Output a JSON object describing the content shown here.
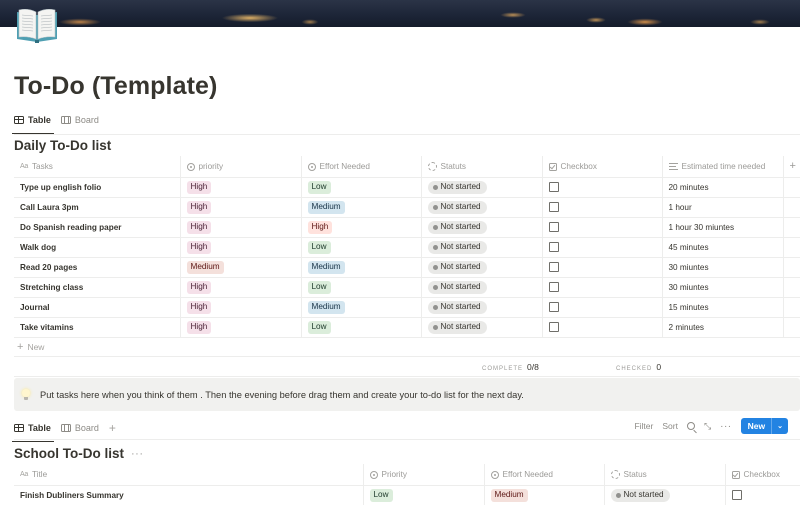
{
  "page": {
    "title": "To-Do (Template)",
    "icon": "open-book-icon"
  },
  "colors": {
    "accent": "#2383e2",
    "tag_high_priority_bg": "#f5e0e9",
    "tag_high_priority_fg": "#4c2337",
    "tag_medium_priority_bg": "#f4e0db",
    "tag_medium_priority_fg": "#5d1715",
    "effort_low_bg": "#dbeddb",
    "effort_low_fg": "#1c3829",
    "effort_medium_bg": "#d3e5ef",
    "effort_medium_fg": "#183347",
    "effort_high_bg": "#ffe2dd",
    "effort_high_fg": "#5d1715",
    "status_bg": "#e9e9e7"
  },
  "daily": {
    "views": [
      {
        "label": "Table",
        "icon": "table-icon",
        "active": true
      },
      {
        "label": "Board",
        "icon": "board-icon",
        "active": false
      }
    ],
    "title": "Daily To-Do list",
    "columns": [
      {
        "label": "Tasks",
        "icon": "text-aa-icon"
      },
      {
        "label": "priority",
        "icon": "select-icon"
      },
      {
        "label": "Effort Needed",
        "icon": "select-icon"
      },
      {
        "label": "Statuts",
        "icon": "status-icon"
      },
      {
        "label": "Checkbox",
        "icon": "checkbox-icon"
      },
      {
        "label": "Estimated time needed",
        "icon": "text-lines-icon"
      }
    ],
    "add_column_label": "+",
    "rows": [
      {
        "task": "Type up english folio",
        "priority": "High",
        "effort": "Low",
        "status": "Not started",
        "checked": false,
        "time": "20 minutes"
      },
      {
        "task": "Call Laura 3pm",
        "priority": "High",
        "effort": "Medium",
        "status": "Not started",
        "checked": false,
        "time": "1 hour"
      },
      {
        "task": "Do Spanish reading paper",
        "priority": "High",
        "effort": "High",
        "status": "Not started",
        "checked": false,
        "time": "1 hour 30 miuntes"
      },
      {
        "task": "Walk dog",
        "priority": "High",
        "effort": "Low",
        "status": "Not started",
        "checked": false,
        "time": "45 minutes"
      },
      {
        "task": "Read 20 pages",
        "priority": "Medium",
        "effort": "Medium",
        "status": "Not started",
        "checked": false,
        "time": "30 miuntes"
      },
      {
        "task": "Stretching class",
        "priority": "High",
        "effort": "Low",
        "status": "Not started",
        "checked": false,
        "time": "30 miuntes"
      },
      {
        "task": "Journal",
        "priority": "High",
        "effort": "Medium",
        "status": "Not started",
        "checked": false,
        "time": "15 minutes"
      },
      {
        "task": "Take vitamins",
        "priority": "High",
        "effort": "Low",
        "status": "Not started",
        "checked": false,
        "time": "2 minutes"
      }
    ],
    "new_row_label": "New",
    "calc": {
      "complete_label": "Complete",
      "complete_value": "0/8",
      "checked_label": "Checked",
      "checked_value": "0"
    }
  },
  "callout": {
    "icon": "light-bulb-icon",
    "text": "Put tasks here when you think of them . Then the evening before drag them and create your to-do list for the next day."
  },
  "school": {
    "views": [
      {
        "label": "Table",
        "icon": "table-icon",
        "active": true
      },
      {
        "label": "Board",
        "icon": "board-icon",
        "active": false
      }
    ],
    "add_view_label": "+",
    "toolbar": {
      "filter": "Filter",
      "sort": "Sort",
      "new": "New"
    },
    "title": "School To-Do list",
    "more_label": "···",
    "columns": [
      {
        "label": "Title",
        "icon": "text-aa-icon"
      },
      {
        "label": "Priority",
        "icon": "select-icon"
      },
      {
        "label": "Effort Needed",
        "icon": "select-icon"
      },
      {
        "label": "Status",
        "icon": "status-icon"
      },
      {
        "label": "Checkbox",
        "icon": "checkbox-icon"
      }
    ],
    "rows": [
      {
        "title": "Finish Dubliners Summary",
        "priority": "Low",
        "effort": "Medium",
        "status": "Not started",
        "checked": false
      }
    ]
  }
}
